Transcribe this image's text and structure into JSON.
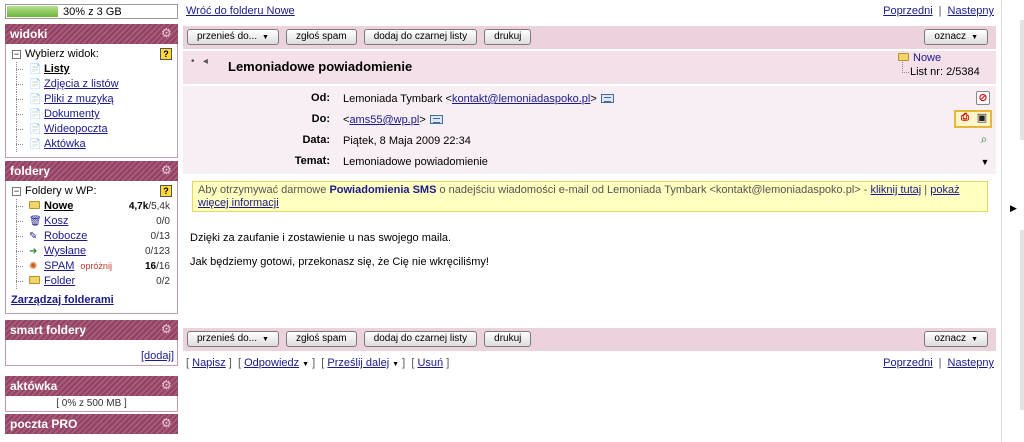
{
  "quota": {
    "text": "30% z 3 GB",
    "used_fraction": 0.3
  },
  "widoki": {
    "title": "widoki",
    "tree_title": "Wybierz widok:",
    "items": [
      {
        "label": "Listy",
        "active": true
      },
      {
        "label": "Zdjęcia z listów"
      },
      {
        "label": "Pliki z muzyką"
      },
      {
        "label": "Dokumenty"
      },
      {
        "label": "Wideopoczta"
      },
      {
        "label": "Aktówka"
      }
    ]
  },
  "foldery": {
    "title": "foldery",
    "tree_title": "Foldery w WP:",
    "items": [
      {
        "label": "Nowe",
        "unread": "4,7k",
        "total": "/5,4k",
        "active": true
      },
      {
        "label": "Kosz",
        "count": "0/0"
      },
      {
        "label": "Robocze",
        "count": "0/13"
      },
      {
        "label": "Wysłane",
        "count": "0/123"
      },
      {
        "label": "SPAM",
        "extra": "opróżnij",
        "unread": "16",
        "total": "/16"
      },
      {
        "label": "Folder",
        "count": "0/2"
      }
    ],
    "manage_label": "Zarządzaj folderami"
  },
  "smart": {
    "title": "smart foldery",
    "add_label": "[dodaj]"
  },
  "aktowka": {
    "title": "aktówka",
    "quota": "[ 0% z 500 MB ]"
  },
  "pro": {
    "title": "poczta PRO"
  },
  "topnav": {
    "back": "Wróć do folderu Nowe",
    "prev": "Poprzedni",
    "sep": "|",
    "next": "Nastepny"
  },
  "toolbar": {
    "move": "przenieś do...",
    "spam": "zgłoś spam",
    "blacklist": "dodaj do czarnej listy",
    "print": "drukuj",
    "mark": "oznacz"
  },
  "message": {
    "subject": "Lemoniadowe powiadomienie",
    "folder": "Nowe",
    "list_nr": "List nr: 2/5384",
    "from_label": "Od:",
    "from_name": "Lemoniada Tymbark <",
    "from_email": "kontakt@lemoniadaspoko.pl",
    "from_end": ">",
    "to_label": "Do:",
    "to_start": "<",
    "to_email": "ams55@wp.pl",
    "to_end": ">",
    "date_label": "Data:",
    "date": "Piątek, 8 Maja 2009 22:34",
    "subject_label": "Temat:",
    "subject_value": "Lemoniadowe powiadomienie",
    "body": [
      "Dzięki za zaufanie i zostawienie u nas swojego maila.",
      "Jak będziemy gotowi, przekonasz się, że Cię nie wkręciliśmy!"
    ]
  },
  "sms": {
    "pre": "Aby otrzymywać darmowe ",
    "bold": "Powiadomienia SMS",
    "mid": " o nadejściu wiadomości e-mail od Lemoniada Tymbark <kontakt@lemoniadaspoko.pl> - ",
    "link1": "kliknij tutaj",
    "sep": " | ",
    "link2": "pokaż więcej informacji"
  },
  "bottomnav": {
    "write": "Napisz",
    "reply": "Odpowiedz",
    "forward": "Prześlij dalej",
    "delete": "Usuń",
    "prev": "Poprzedni",
    "sep": "|",
    "next": "Nastepny"
  },
  "colors": {
    "accent": "#8f4262",
    "toolbar_bg": "#ecd2dc",
    "link": "#1a1a8c",
    "banner_bg": "#ffffbf"
  }
}
